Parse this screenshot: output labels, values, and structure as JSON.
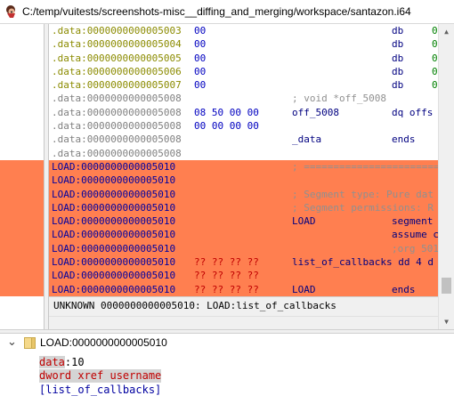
{
  "window": {
    "title": "C:/temp/vuitests/screenshots-misc__diffing_and_merging/workspace/santazon.i64"
  },
  "colors": {
    "selection": "#ff7f50",
    "segment_name": "#8b8b00",
    "address": "#808080",
    "data_bytes": "#0000c0",
    "code_address": "#0000a0",
    "comment": "#909090",
    "keyword": "#000080",
    "unknown_bytes": "#c00000"
  },
  "listing": {
    "rows": [
      {
        "addr": ".data:0000000000005003",
        "addr_color": "#8b8b00",
        "bytes": "00",
        "label": "",
        "op": "db",
        "arg": "0",
        "selected": false
      },
      {
        "addr": ".data:0000000000005004",
        "addr_color": "#8b8b00",
        "bytes": "00",
        "label": "",
        "op": "db",
        "arg": "0",
        "selected": false
      },
      {
        "addr": ".data:0000000000005005",
        "addr_color": "#8b8b00",
        "bytes": "00",
        "label": "",
        "op": "db",
        "arg": "0",
        "selected": false
      },
      {
        "addr": ".data:0000000000005006",
        "addr_color": "#8b8b00",
        "bytes": "00",
        "label": "",
        "op": "db",
        "arg": "0",
        "selected": false
      },
      {
        "addr": ".data:0000000000005007",
        "addr_color": "#8b8b00",
        "bytes": "00",
        "label": "",
        "op": "db",
        "arg": "0",
        "selected": false
      },
      {
        "addr": ".data:0000000000005008",
        "addr_color": "#808080",
        "bytes": "",
        "label": "; void *off_5008",
        "label_color": "#909090",
        "op": "",
        "arg": "",
        "selected": false
      },
      {
        "addr": ".data:0000000000005008",
        "addr_color": "#808080",
        "bytes": "08 50 00 00",
        "label": "off_5008",
        "label_color": "#000080",
        "op": "dq offs",
        "arg": "",
        "selected": false
      },
      {
        "addr": ".data:0000000000005008",
        "addr_color": "#808080",
        "bytes": "00 00 00 00",
        "label": "",
        "op": "",
        "arg": "",
        "selected": false
      },
      {
        "addr": ".data:0000000000005008",
        "addr_color": "#808080",
        "bytes": "",
        "label": "_data",
        "label_color": "#000080",
        "op": "ends",
        "arg": "",
        "selected": false
      },
      {
        "addr": ".data:0000000000005008",
        "addr_color": "#808080",
        "bytes": "",
        "label": "",
        "op": "",
        "arg": "",
        "selected": false
      },
      {
        "addr": "LOAD:0000000000005010",
        "addr_color": "#0000a0",
        "bytes": "",
        "label": "; ========================",
        "label_color": "#909090",
        "op": "",
        "arg": "",
        "selected": true
      },
      {
        "addr": "LOAD:0000000000005010",
        "addr_color": "#0000a0",
        "bytes": "",
        "label": "",
        "op": "",
        "arg": "",
        "selected": true
      },
      {
        "addr": "LOAD:0000000000005010",
        "addr_color": "#0000a0",
        "bytes": "",
        "label": "; Segment type: Pure dat",
        "label_color": "#909090",
        "op": "",
        "arg": "",
        "selected": true
      },
      {
        "addr": "LOAD:0000000000005010",
        "addr_color": "#0000a0",
        "bytes": "",
        "label": "; Segment permissions: R",
        "label_color": "#909090",
        "op": "",
        "arg": "",
        "selected": true
      },
      {
        "addr": "LOAD:0000000000005010",
        "addr_color": "#0000a0",
        "bytes": "",
        "label": "LOAD",
        "label_color": "#000080",
        "op": "segment (",
        "op_color": "#000080",
        "arg": "",
        "selected": true
      },
      {
        "addr": "LOAD:0000000000005010",
        "addr_color": "#0000a0",
        "bytes": "",
        "label": "",
        "op": "assume c",
        "op_color": "#000080",
        "arg": "",
        "selected": true
      },
      {
        "addr": "LOAD:0000000000005010",
        "addr_color": "#0000a0",
        "bytes": "",
        "label": "",
        "op": ";org 501",
        "op_color": "#909090",
        "arg": "",
        "selected": true
      },
      {
        "addr": "LOAD:0000000000005010",
        "addr_color": "#0000a0",
        "bytes": "?? ?? ?? ??",
        "bytes_color": "#c00000",
        "label": "list_of_callbacks dd 4 d",
        "label_color": "#000080",
        "op": "",
        "arg": "",
        "selected": true
      },
      {
        "addr": "LOAD:0000000000005010",
        "addr_color": "#0000a0",
        "bytes": "?? ?? ?? ??",
        "bytes_color": "#c00000",
        "label": "",
        "op": "",
        "arg": "",
        "selected": true
      },
      {
        "addr": "LOAD:0000000000005010",
        "addr_color": "#0000a0",
        "bytes": "?? ?? ?? ??",
        "bytes_color": "#c00000",
        "label": "LOAD",
        "label_color": "#000080",
        "op": "ends",
        "op_color": "#000080",
        "arg": "",
        "selected": true
      }
    ]
  },
  "status": {
    "text": "UNKNOWN 0000000000005010: LOAD:list_of_callbacks"
  },
  "tree": {
    "title": "LOAD:0000000000005010",
    "lines": {
      "line1_a": "data",
      "line1_b": ":10",
      "line2": "dword xref username",
      "line3": "[list_of_callbacks]"
    }
  }
}
